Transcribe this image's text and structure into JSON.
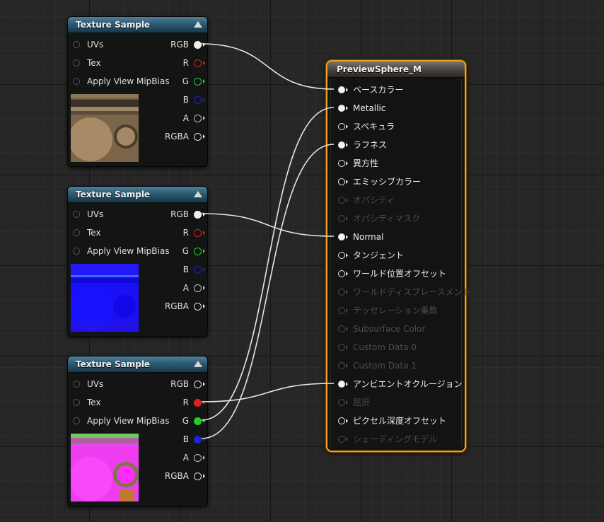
{
  "texture_nodes": [
    {
      "title": "Texture Sample",
      "inputs": [
        "UVs",
        "Tex",
        "Apply View MipBias"
      ],
      "outputs": [
        {
          "label": "RGB",
          "color": "#f0f0f0",
          "connected": true
        },
        {
          "label": "R",
          "color": "#e02020",
          "connected": false
        },
        {
          "label": "G",
          "color": "#20d020",
          "connected": false
        },
        {
          "label": "B",
          "color": "#2020e0",
          "connected": false
        },
        {
          "label": "A",
          "color": "#bbbbbb",
          "connected": false
        },
        {
          "label": "RGBA",
          "color": "#dddddd",
          "connected": false
        }
      ],
      "thumbnail": "base-color-texture"
    },
    {
      "title": "Texture Sample",
      "inputs": [
        "UVs",
        "Tex",
        "Apply View MipBias"
      ],
      "outputs": [
        {
          "label": "RGB",
          "color": "#f0f0f0",
          "connected": true
        },
        {
          "label": "R",
          "color": "#e02020",
          "connected": false
        },
        {
          "label": "G",
          "color": "#20d020",
          "connected": false
        },
        {
          "label": "B",
          "color": "#2020e0",
          "connected": false
        },
        {
          "label": "A",
          "color": "#bbbbbb",
          "connected": false
        },
        {
          "label": "RGBA",
          "color": "#dddddd",
          "connected": false
        }
      ],
      "thumbnail": "normal-map-texture"
    },
    {
      "title": "Texture Sample",
      "inputs": [
        "UVs",
        "Tex",
        "Apply View MipBias"
      ],
      "outputs": [
        {
          "label": "RGB",
          "color": "#dddddd",
          "connected": false
        },
        {
          "label": "R",
          "color": "#e02020",
          "connected": true
        },
        {
          "label": "G",
          "color": "#20d020",
          "connected": true
        },
        {
          "label": "B",
          "color": "#2020e0",
          "connected": true
        },
        {
          "label": "A",
          "color": "#bbbbbb",
          "connected": false
        },
        {
          "label": "RGBA",
          "color": "#dddddd",
          "connected": false
        }
      ],
      "thumbnail": "orm-packed-texture"
    }
  ],
  "material_node": {
    "title": "PreviewSphere_M",
    "pins": [
      {
        "label": "ベースカラー",
        "enabled": true,
        "connected": true
      },
      {
        "label": "Metallic",
        "enabled": true,
        "connected": true
      },
      {
        "label": "スペキュラ",
        "enabled": true,
        "connected": false
      },
      {
        "label": "ラフネス",
        "enabled": true,
        "connected": true
      },
      {
        "label": "異方性",
        "enabled": true,
        "connected": false
      },
      {
        "label": "エミッシブカラー",
        "enabled": true,
        "connected": false
      },
      {
        "label": "オパシティ",
        "enabled": false,
        "connected": false
      },
      {
        "label": "オパシティマスク",
        "enabled": false,
        "connected": false
      },
      {
        "label": "Normal",
        "enabled": true,
        "connected": true
      },
      {
        "label": "タンジェント",
        "enabled": true,
        "connected": false
      },
      {
        "label": "ワールド位置オフセット",
        "enabled": true,
        "connected": false
      },
      {
        "label": "ワールドディスプレースメント",
        "enabled": false,
        "connected": false
      },
      {
        "label": "テッセレーション乗数",
        "enabled": false,
        "connected": false
      },
      {
        "label": "Subsurface Color",
        "enabled": false,
        "connected": false
      },
      {
        "label": "Custom Data 0",
        "enabled": false,
        "connected": false
      },
      {
        "label": "Custom Data 1",
        "enabled": false,
        "connected": false
      },
      {
        "label": "アンビエントオクルージョン",
        "enabled": true,
        "connected": true
      },
      {
        "label": "屈折",
        "enabled": false,
        "connected": false
      },
      {
        "label": "ピクセル深度オフセット",
        "enabled": true,
        "connected": false
      },
      {
        "label": "シェーディングモデル",
        "enabled": false,
        "connected": false
      }
    ]
  },
  "wire_color": "#e6e6e6",
  "accent_selection_color": "#f2a01a"
}
